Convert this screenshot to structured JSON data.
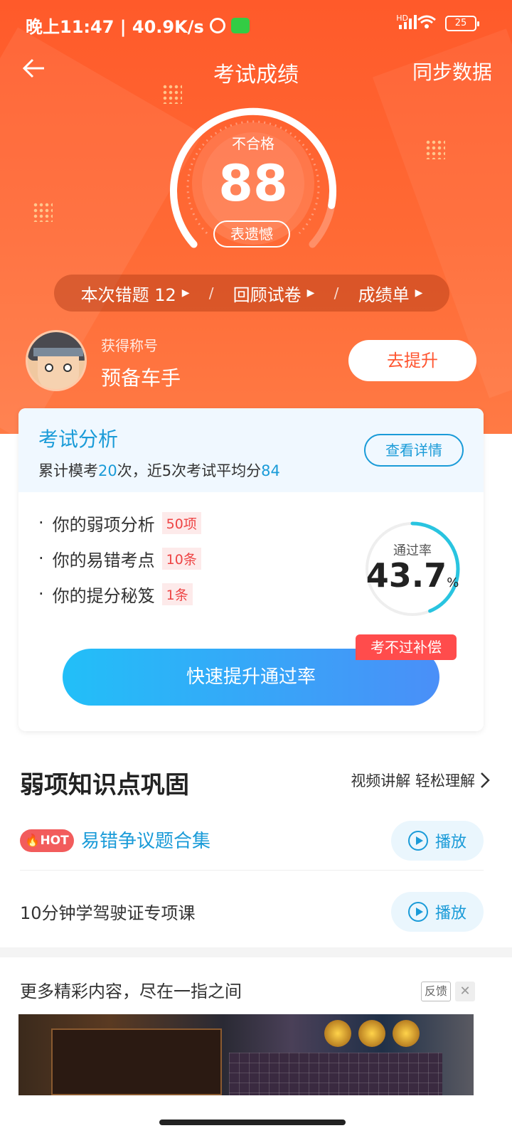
{
  "statusbar": {
    "time_speed": "晚上11:47 | 40.9K/s",
    "network": "HD",
    "battery": "25"
  },
  "nav": {
    "back_icon": "arrow-left-icon",
    "title": "考试成绩",
    "sync": "同步数据"
  },
  "score": {
    "status": "不合格",
    "value": "88",
    "fraction": 0.88,
    "action": "表遗憾"
  },
  "quick_links": {
    "wrong": "本次错题 12",
    "review": "回顾试卷",
    "report": "成绩单",
    "separator": "/"
  },
  "profile": {
    "title_label": "获得称号",
    "title_value": "预备车手",
    "improve_button": "去提升"
  },
  "analysis": {
    "title": "考试分析",
    "sub_prefix": "累计模考",
    "sub_count": "20",
    "sub_middle": "次，近5次考试平均分",
    "sub_avg": "84",
    "detail_button": "查看详情",
    "items": [
      {
        "label": "你的弱项分析",
        "tag": "50项"
      },
      {
        "label": "你的易错考点",
        "tag": "10条"
      },
      {
        "label": "你的提分秘笈",
        "tag": "1条"
      }
    ],
    "pass_rate_label": "通过率",
    "pass_rate_value": "43.7",
    "pass_rate_unit": "%",
    "pass_rate_fraction": 0.437,
    "boost_button": "快速提升通过率",
    "compensation_badge": "考不过补偿"
  },
  "weak_points": {
    "title": "弱项知识点巩固",
    "more": "视频讲解 轻松理解",
    "rows": [
      {
        "badge": "HOT",
        "text": "易错争议题合集",
        "play": "播放"
      },
      {
        "text": "10分钟学驾驶证专项课",
        "play": "播放"
      }
    ]
  },
  "ad": {
    "title": "更多精彩内容，尽在一指之间",
    "feedback": "反馈",
    "close": "✕"
  },
  "colors": {
    "hero": "#ff5a2a",
    "accent_blue": "#1a9bd8",
    "tag_red": "#ee4444",
    "badge_red": "#ff4c4c"
  }
}
